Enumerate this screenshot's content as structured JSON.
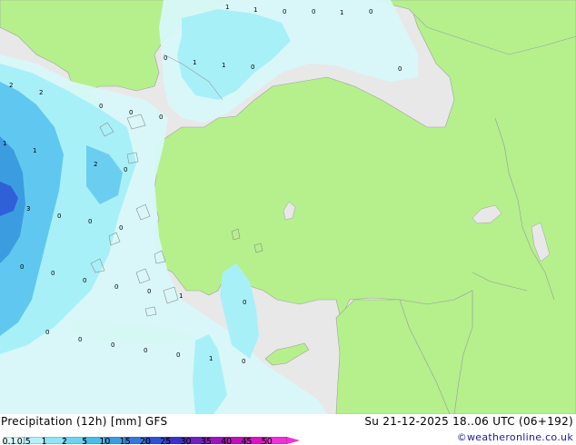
{
  "title": "Precipitation (12h) [mm] GFS",
  "run_info": "Su 21-12-2025 18..06 UTC (06+192)",
  "credit": "©weatheronline.co.uk",
  "colors": {
    "land": "#b5f08c",
    "sea": "#e8e8e8",
    "border": "#a0a0a0",
    "precip_light": "#d8f8fa",
    "precip_med": "#a8f0f8",
    "precip_heavy": "#60c8f0",
    "precip_strong": "#3c9ce0",
    "precip_max": "#3060d8"
  },
  "legend": {
    "ticks": [
      "0.1",
      "0.5",
      "1",
      "2",
      "5",
      "10",
      "15",
      "20",
      "25",
      "30",
      "35",
      "40",
      "45",
      "50"
    ],
    "colors": [
      "#d8f8fa",
      "#b4f0f8",
      "#90e4f4",
      "#6cd4f0",
      "#48bce8",
      "#3c9ce0",
      "#3478dc",
      "#3050d4",
      "#4030c8",
      "#7020c0",
      "#9c14bc",
      "#c010bc",
      "#e010c8",
      "#f030d8"
    ]
  },
  "map_values": [
    {
      "label": "1"
    },
    {
      "label": "1"
    },
    {
      "label": "0"
    },
    {
      "label": "0"
    },
    {
      "label": "1"
    },
    {
      "label": "0"
    },
    {
      "label": "0"
    },
    {
      "label": "1"
    },
    {
      "label": "1"
    },
    {
      "label": "0"
    },
    {
      "label": "0"
    },
    {
      "label": "2"
    },
    {
      "label": "2"
    },
    {
      "label": "0"
    },
    {
      "label": "0"
    },
    {
      "label": "0"
    },
    {
      "label": "1"
    },
    {
      "label": "1"
    },
    {
      "label": "2"
    },
    {
      "label": "0"
    },
    {
      "label": "3"
    },
    {
      "label": "0"
    },
    {
      "label": "0"
    },
    {
      "label": "0"
    },
    {
      "label": "0"
    },
    {
      "label": "0"
    },
    {
      "label": "0"
    },
    {
      "label": "0"
    },
    {
      "label": "0"
    },
    {
      "label": "1"
    },
    {
      "label": "0"
    },
    {
      "label": "0"
    },
    {
      "label": "0"
    },
    {
      "label": "0"
    },
    {
      "label": "0"
    },
    {
      "label": "0"
    },
    {
      "label": "1"
    },
    {
      "label": "0"
    }
  ]
}
